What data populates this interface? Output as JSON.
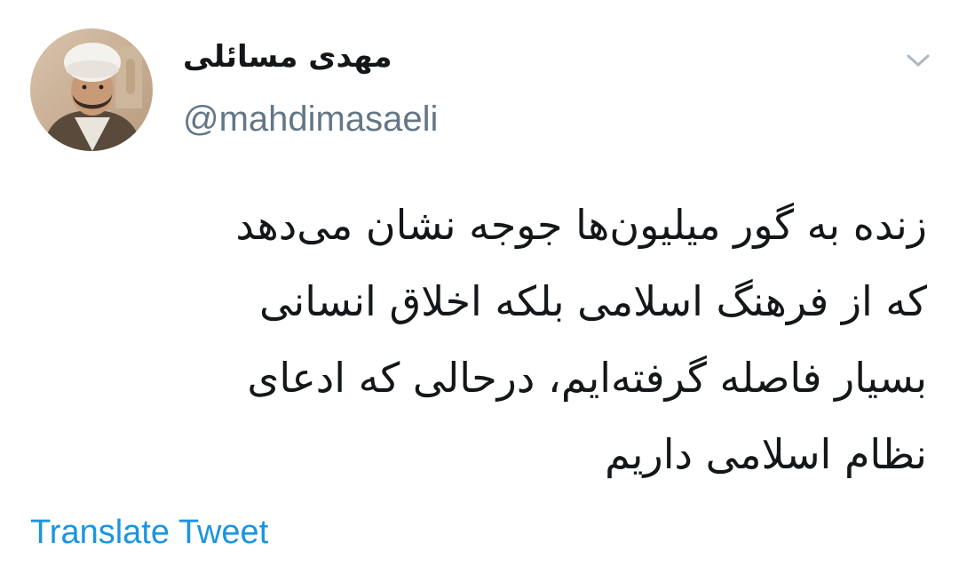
{
  "author": {
    "display_name": "مهدی مسائلی",
    "handle": "@mahdimasaeli",
    "avatar_icon": "user-avatar-photo"
  },
  "menu": {
    "icon": "chevron-down-icon"
  },
  "tweet": {
    "lines": [
      "زنده به گور میلیون‌ها جوجه نشان می‌دهد",
      "که از فرهنگ اسلامی بلکه اخلاق انسانی",
      "بسیار فاصله گرفته‌ایم، درحالی که ادعای",
      "نظام اسلامی داریم"
    ]
  },
  "actions": {
    "translate_label": "Translate Tweet"
  },
  "colors": {
    "text_primary": "#14171a",
    "text_secondary": "#657786",
    "link": "#1b95e0",
    "chevron": "#aab8c2"
  }
}
